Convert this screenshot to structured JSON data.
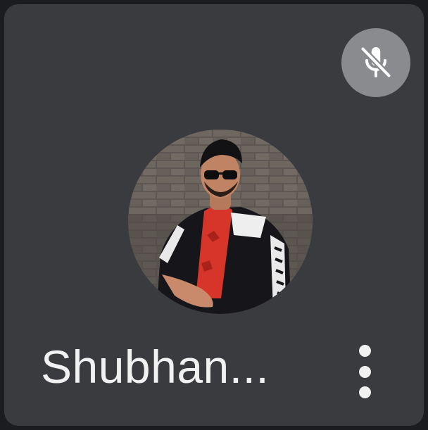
{
  "participant": {
    "name": "Shubhan...",
    "muted": true,
    "avatar_icon": "participant-photo"
  },
  "icons": {
    "mute_indicator": "mic-off-icon",
    "more_options": "more-vert-icon"
  },
  "colors": {
    "tile_background": "#3a3b3f",
    "mute_badge": "#8a8b8f",
    "text": "#f1f1f1"
  }
}
